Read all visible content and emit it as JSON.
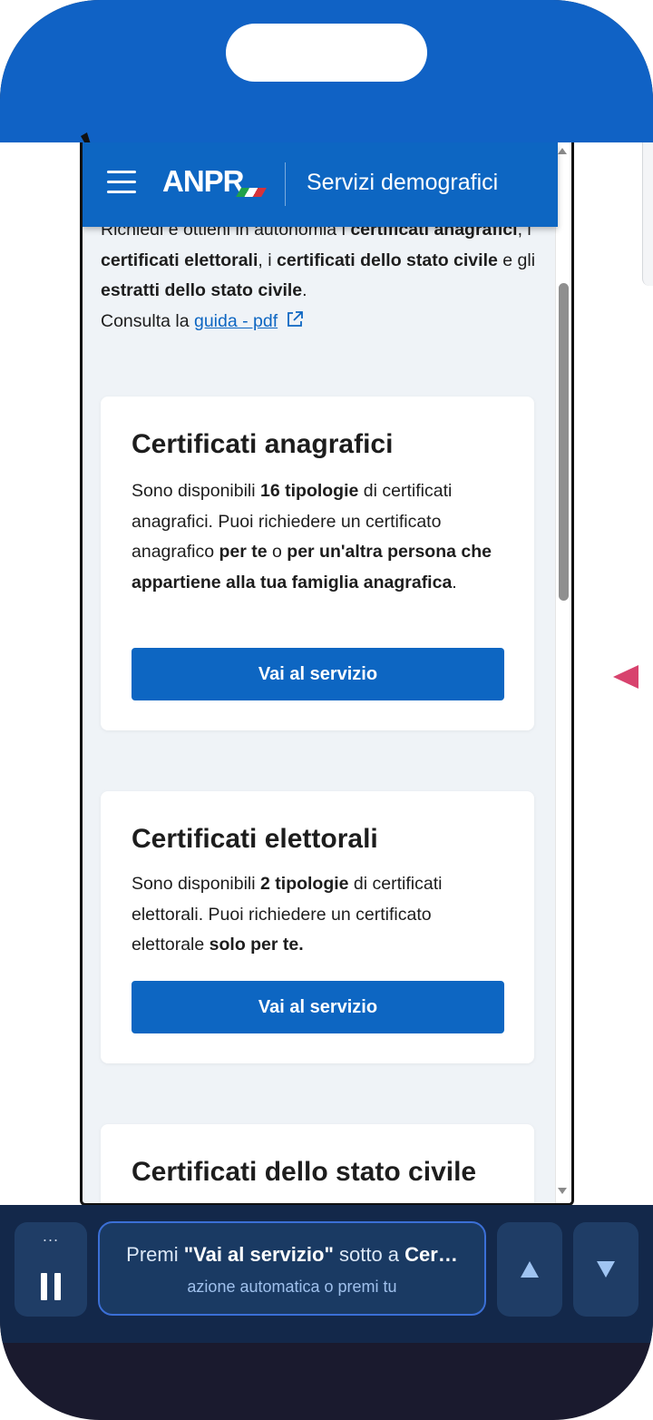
{
  "header": {
    "logo_text": "ANPR",
    "title": "Servizi demografici"
  },
  "intro": {
    "line1_start": "Richiedi e ottieni in autonomia i ",
    "b1": "certificati anagrafici",
    "t1": ", i ",
    "b2": "certificati elettorali",
    "t2": ", i ",
    "b3": "certificati dello stato civile",
    "t3": " e gli ",
    "b4": "estratti dello stato civile",
    "t4": ".",
    "consult_prefix": "Consulta la ",
    "guide_link": "guida - pdf"
  },
  "cards": [
    {
      "title": "Certificati anagrafici",
      "d1": "Sono disponibili ",
      "b1": "16 tipologie",
      "d2": " di certificati anagrafici. Puoi richiedere un certificato anagrafico ",
      "b2": "per te",
      "d3": " o ",
      "b3": "per un'altra persona che appartiene alla tua famiglia anagrafica",
      "d4": ".",
      "button": "Vai al servizio"
    },
    {
      "title": "Certificati elettorali",
      "d1": "Sono disponibili ",
      "b1": "2 tipologie",
      "d2": " di certificati elettorali. Puoi richiedere un certificato elettorale ",
      "b2": "solo per te.",
      "button": "Vai al servizio"
    },
    {
      "title": "Certificati dello stato civile"
    }
  ],
  "controls": {
    "pause_dots": "...",
    "instruction_prefix": "Premi ",
    "instruction_button": "\"Vai al servizio\"",
    "instruction_mid": " sotto a ",
    "instruction_target": "Cer…",
    "instruction_sub": "azione automatica o premi tu"
  },
  "colors": {
    "brand_blue": "#0d66c2",
    "page_bg": "#eff3f7",
    "control_bg": "#13284a",
    "accent_pink": "#d8436e"
  },
  "icons": {
    "menu": "hamburger-icon",
    "external": "external-link-icon",
    "pause": "pause-icon",
    "prev": "arrow-up-icon",
    "next": "arrow-down-icon"
  }
}
